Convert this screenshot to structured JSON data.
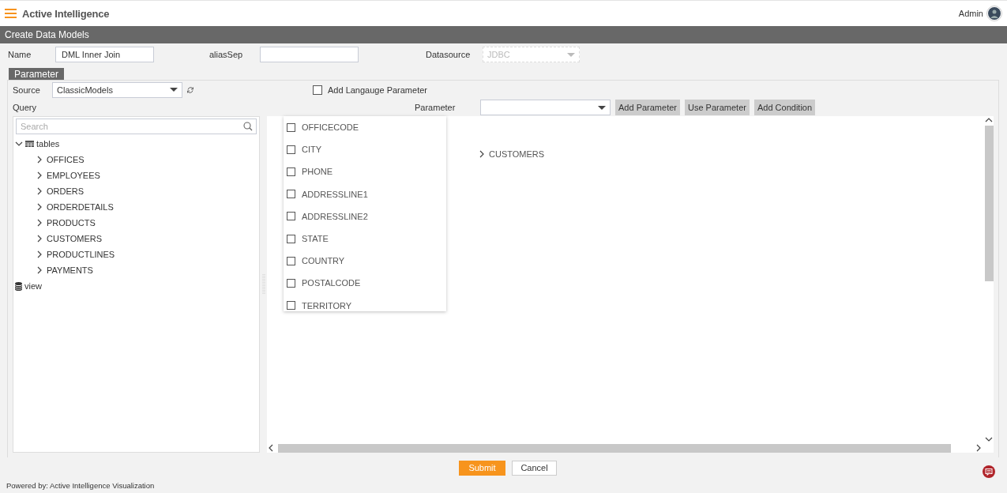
{
  "header": {
    "title": "Active Intelligence",
    "user": "Admin"
  },
  "page_title": "Create Data Models",
  "fields": [
    {
      "label": "Name",
      "kind": "text",
      "value": "DML Inner Join"
    },
    {
      "label": "aliasSep",
      "kind": "text"
    },
    {
      "label": "Datasource",
      "kind": "select",
      "value": "JDBC",
      "disabled": true
    }
  ],
  "tabs": [
    {
      "label": "Parameter",
      "selected": true
    }
  ],
  "source": {
    "label": "Source",
    "value": "ClassicModels"
  },
  "language_parameter": {
    "label": "Add Langauge Parameter",
    "checked": false
  },
  "query_label": "Query",
  "parameter": {
    "label": "Parameter"
  },
  "buttons": [
    "Add Parameter",
    "Use Parameter",
    "Add Condition"
  ],
  "tree": {
    "search_placeholder": "Search",
    "items": [
      {
        "label": "tables",
        "kind": "table",
        "expanded": true,
        "children": [
          {
            "label": "OFFICES",
            "expanded": false
          },
          {
            "label": "EMPLOYEES",
            "expanded": false
          },
          {
            "label": "ORDERS",
            "expanded": false
          },
          {
            "label": "ORDERDETAILS",
            "expanded": false
          },
          {
            "label": "PRODUCTS",
            "expanded": false
          },
          {
            "label": "CUSTOMERS",
            "expanded": false
          },
          {
            "label": "PRODUCTLINES",
            "expanded": false
          },
          {
            "label": "PAYMENTS",
            "expanded": false
          }
        ]
      },
      {
        "label": "view",
        "kind": "database"
      }
    ]
  },
  "column_dropdown": [
    {
      "label": "OFFICECODE",
      "checked": false
    },
    {
      "label": "CITY",
      "checked": false
    },
    {
      "label": "PHONE",
      "checked": false
    },
    {
      "label": "ADDRESSLINE1",
      "checked": false
    },
    {
      "label": "ADDRESSLINE2",
      "checked": false
    },
    {
      "label": "STATE",
      "checked": false
    },
    {
      "label": "COUNTRY",
      "checked": false
    },
    {
      "label": "POSTALCODE",
      "checked": false
    },
    {
      "label": "TERRITORY",
      "checked": false
    }
  ],
  "canvas_nodes": [
    {
      "label": "CUSTOMERS",
      "expanded": false
    }
  ],
  "actions": [
    {
      "label": "Submit",
      "kind": "primary"
    },
    {
      "label": "Cancel",
      "kind": "secondary"
    }
  ],
  "footer": "Powered by: Active Intelligence Visualization"
}
